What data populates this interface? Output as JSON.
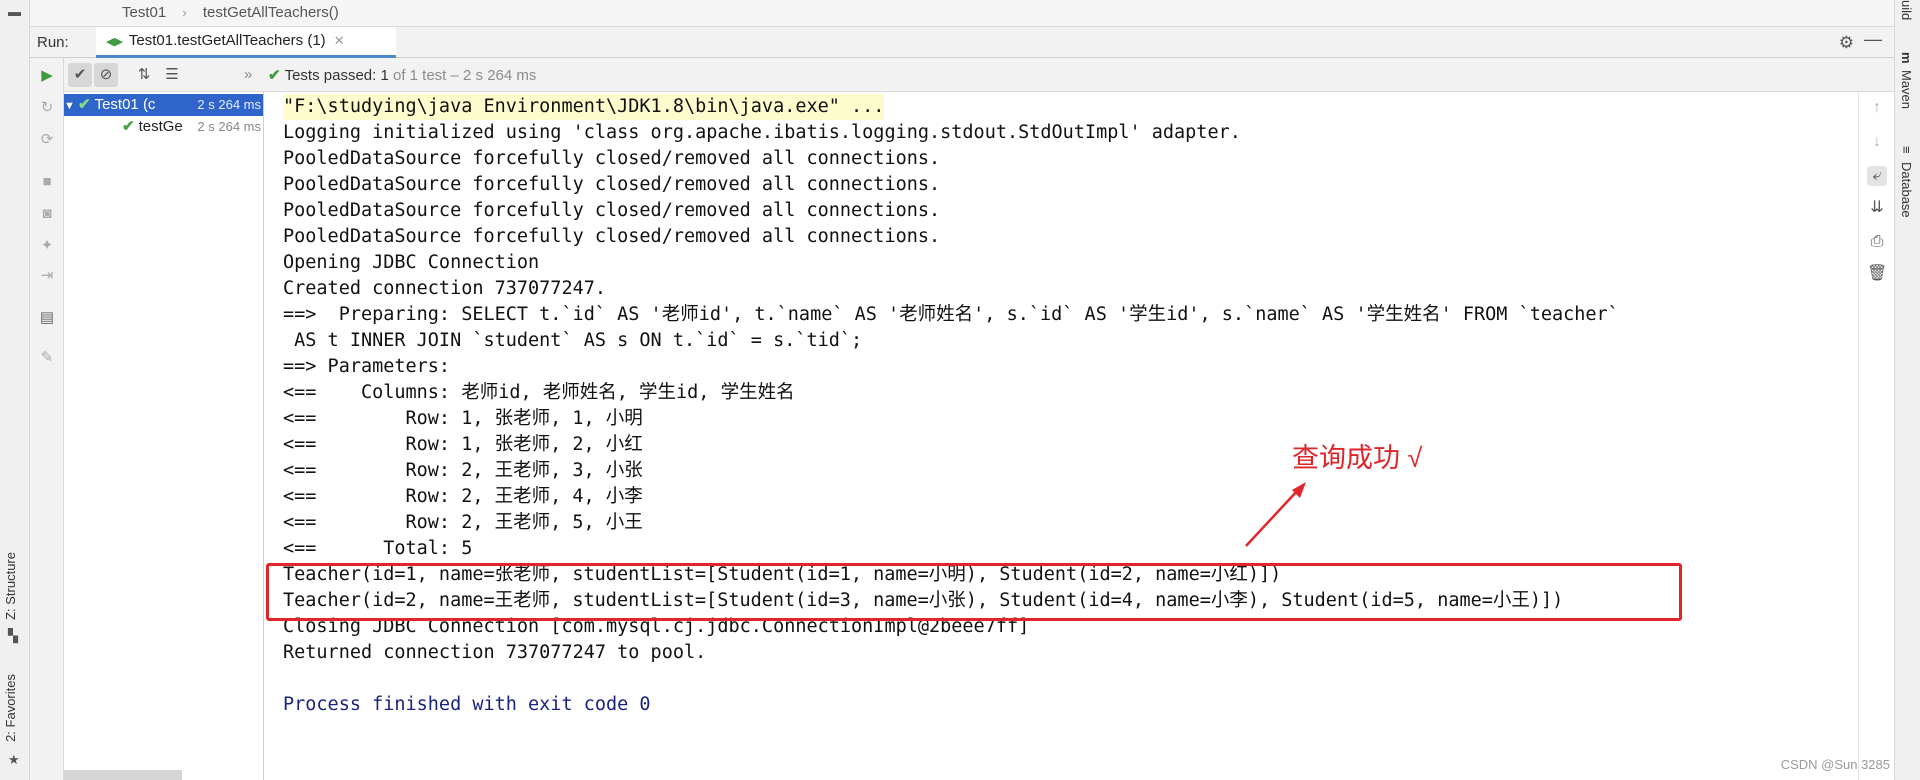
{
  "breadcrumb": {
    "items": [
      "Test01",
      "testGetAllTeachers()"
    ]
  },
  "run": {
    "label": "Run:",
    "tab_label": "Test01.testGetAllTeachers (1)"
  },
  "status": {
    "passed_label": "Tests passed: 1",
    "detail": "of 1 test – 2 s 264 ms"
  },
  "tree": {
    "items": [
      {
        "label": "Test01 (c",
        "duration": "2 s 264 ms"
      },
      {
        "label": "testGe",
        "duration": "2 s 264 ms"
      }
    ]
  },
  "console": {
    "lines": [
      "\"F:\\studying\\java Environment\\JDK1.8\\bin\\java.exe\" ...",
      "Logging initialized using 'class org.apache.ibatis.logging.stdout.StdOutImpl' adapter.",
      "PooledDataSource forcefully closed/removed all connections.",
      "PooledDataSource forcefully closed/removed all connections.",
      "PooledDataSource forcefully closed/removed all connections.",
      "PooledDataSource forcefully closed/removed all connections.",
      "Opening JDBC Connection",
      "Created connection 737077247.",
      "==>  Preparing: SELECT t.`id` AS '老师id', t.`name` AS '老师姓名', s.`id` AS '学生id', s.`name` AS '学生姓名' FROM `teacher`",
      " AS t INNER JOIN `student` AS s ON t.`id` = s.`tid`;",
      "==> Parameters: ",
      "<==    Columns: 老师id, 老师姓名, 学生id, 学生姓名",
      "<==        Row: 1, 张老师, 1, 小明",
      "<==        Row: 1, 张老师, 2, 小红",
      "<==        Row: 2, 王老师, 3, 小张",
      "<==        Row: 2, 王老师, 4, 小李",
      "<==        Row: 2, 王老师, 5, 小王",
      "<==      Total: 5",
      "Teacher(id=1, name=张老师, studentList=[Student(id=1, name=小明), Student(id=2, name=小红)])",
      "Teacher(id=2, name=王老师, studentList=[Student(id=3, name=小张), Student(id=4, name=小李), Student(id=5, name=小王)])",
      "Closing JDBC Connection [com.mysql.cj.jdbc.ConnectionImpl@2beee7ff]",
      "Returned connection 737077247 to pool.",
      "",
      "Process finished with exit code 0"
    ]
  },
  "annotation": "查询成功 √",
  "sidebars": {
    "left": [
      "Z: Structure",
      "2: Favorites"
    ],
    "right": [
      "uild",
      "Maven",
      "Database"
    ]
  },
  "watermark": "CSDN @Sun 3285",
  "colors": {
    "accent": "#2f65ca",
    "success": "#3d9a3d",
    "annotation": "#e0262a",
    "exit_text": "#1a237e",
    "cmd_highlight": "#fcfccc"
  },
  "icons": [
    "settings-icon",
    "minimize-icon",
    "rerun-icon",
    "check-icon",
    "stop-icon",
    "soft-wrap-icon",
    "print-icon",
    "trash-icon"
  ]
}
